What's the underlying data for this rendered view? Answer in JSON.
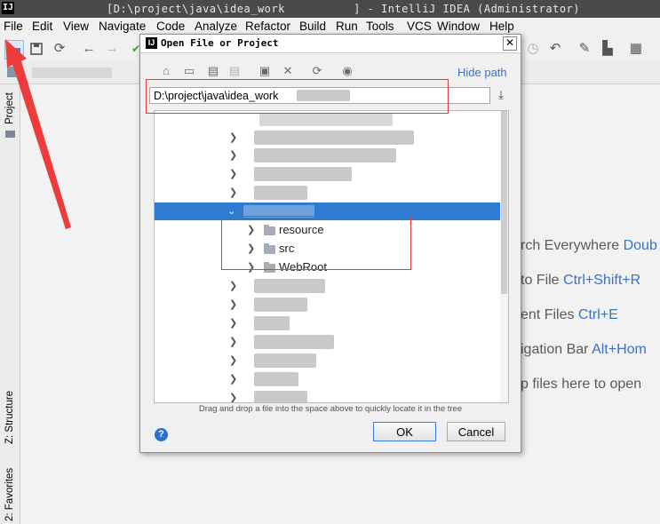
{
  "window": {
    "title": "[D:\\project\\java\\idea_work          ] - IntelliJ IDEA (Administrator)",
    "logo": "IJ"
  },
  "menu": [
    "File",
    "Edit",
    "View",
    "Navigate",
    "Code",
    "Analyze",
    "Refactor",
    "Build",
    "Run",
    "Tools",
    "VCS",
    "Window",
    "Help"
  ],
  "toolbar_icons": [
    "open-folder-icon",
    "save-icon",
    "sync-icon",
    "back-icon",
    "forward-icon",
    "hammer-icon",
    "revert-icon",
    "wrench-icon",
    "project-structure-icon",
    "sdk-icon",
    "search-icon"
  ],
  "left_strip": {
    "project": "Project",
    "structure": "Z: Structure",
    "favorites": "2: Favorites"
  },
  "editor_hints": [
    {
      "text": "rch Everywhere ",
      "key": "Doub"
    },
    {
      "text": "to File ",
      "key": "Ctrl+Shift+R"
    },
    {
      "text": "ent Files ",
      "key": "Ctrl+E"
    },
    {
      "text": "igation Bar ",
      "key": "Alt+Hom"
    },
    {
      "text": "p files here to open",
      "key": ""
    }
  ],
  "dialog": {
    "title": "Open File or Project",
    "hide_path": "Hide path",
    "path_value": "D:\\project\\java\\idea_work",
    "tree_items": [
      "resource",
      "src",
      "WebRoot"
    ],
    "drag_drop_hint": "Drag and drop a file into the space above to quickly locate it in the tree",
    "help": "?",
    "ok": "OK",
    "cancel": "Cancel"
  },
  "colors": {
    "selection": "#2f7bd1",
    "link": "#3573d3",
    "annotation": "#e53a3a"
  }
}
